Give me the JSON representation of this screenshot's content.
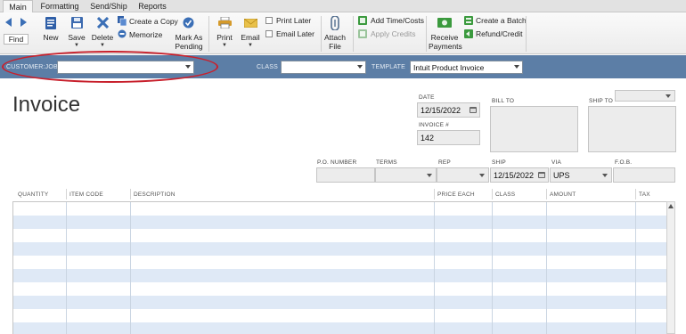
{
  "tabs": [
    {
      "label": "Main",
      "active": true
    },
    {
      "label": "Formatting",
      "active": false
    },
    {
      "label": "Send/Ship",
      "active": false
    },
    {
      "label": "Reports",
      "active": false
    }
  ],
  "ribbon": {
    "find": "Find",
    "new": "New",
    "save": "Save",
    "delete": "Delete",
    "create_copy": "Create a Copy",
    "memorize": "Memorize",
    "mark_as_pending": [
      "Mark As",
      "Pending"
    ],
    "print": "Print",
    "email": "Email",
    "print_later": "Print Later",
    "email_later": "Email Later",
    "attach_file": [
      "Attach",
      "File"
    ],
    "add_time_costs": "Add Time/Costs",
    "apply_credits": "Apply Credits",
    "receive_payments": [
      "Receive",
      "Payments"
    ],
    "create_batch": "Create a Batch",
    "refund_credit": "Refund/Credit"
  },
  "header_strip": {
    "customer_job_label": "CUSTOMER:JOB",
    "customer_job_value": "",
    "class_label": "CLASS",
    "class_value": "",
    "template_label": "TEMPLATE",
    "template_value": "Intuit Product Invoice"
  },
  "form": {
    "title": "Invoice",
    "date_label": "DATE",
    "date_value": "12/15/2022",
    "invoice_no_label": "INVOICE #",
    "invoice_no_value": "142",
    "bill_to_label": "BILL TO",
    "ship_to_label": "SHIP TO",
    "po_number_label": "P.O. NUMBER",
    "terms_label": "TERMS",
    "rep_label": "REP",
    "ship_label": "SHIP",
    "ship_value": "12/15/2022",
    "via_label": "VIA",
    "via_value": "UPS",
    "fob_label": "F.O.B."
  },
  "line_items": {
    "columns": [
      "QUANTITY",
      "ITEM CODE",
      "DESCRIPTION",
      "PRICE EACH",
      "CLASS",
      "AMOUNT",
      "TAX"
    ],
    "rows": []
  },
  "colors": {
    "header_strip": "#5c7ea6",
    "row_alt": "#dfe9f6",
    "annotation": "#c8202c"
  },
  "icons": {
    "find": "arrow-left-right-icon",
    "new": "new-document-icon",
    "save": "floppy-icon",
    "delete": "x-delete-icon",
    "create_copy": "copy-icon",
    "memorize": "memorize-icon",
    "mark_as_pending": "pending-icon",
    "print": "printer-icon",
    "email": "envelope-icon",
    "attach_file": "paperclip-icon",
    "add_time_costs": "time-costs-icon",
    "apply_credits": "credits-icon",
    "receive_payments": "payments-icon",
    "create_batch": "batch-icon",
    "refund_credit": "refund-icon"
  }
}
